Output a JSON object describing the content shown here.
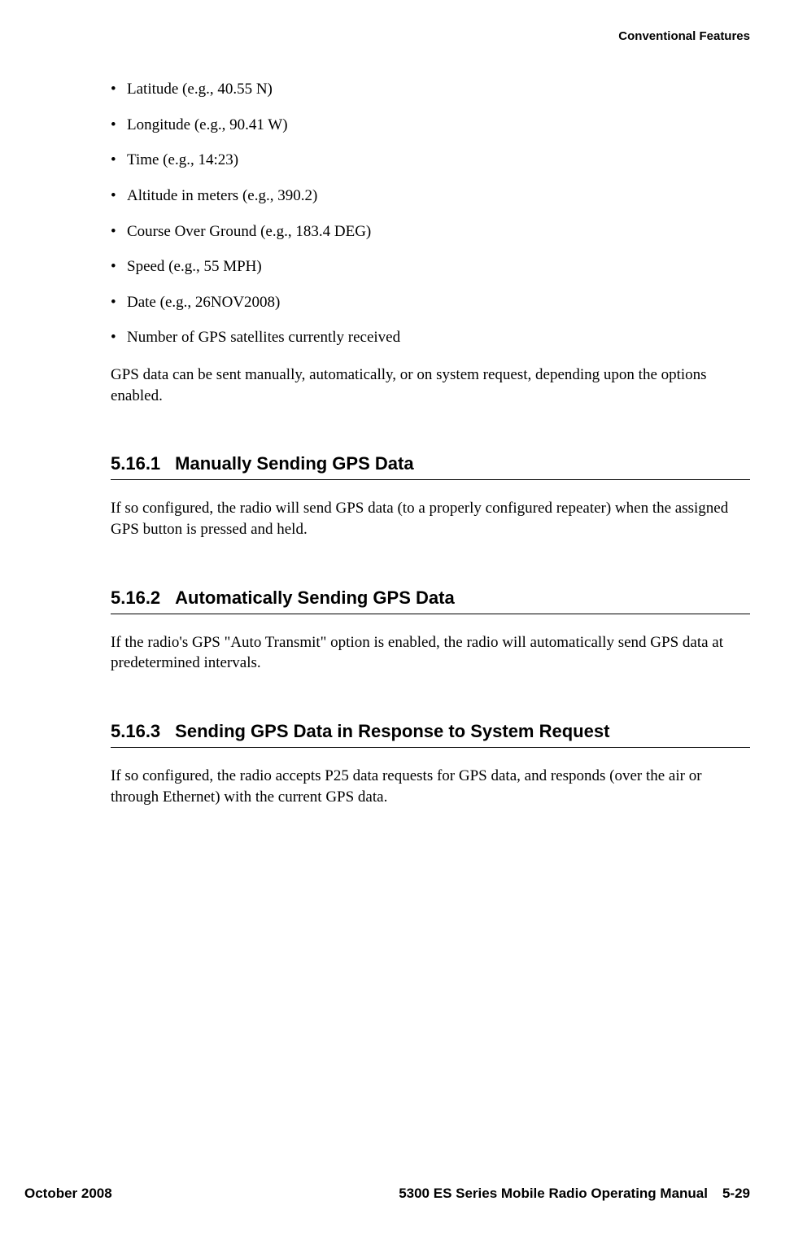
{
  "running_head": "Conventional Features",
  "bullets": [
    "Latitude (e.g., 40.55 N)",
    "Longitude (e.g., 90.41 W)",
    "Time (e.g., 14:23)",
    "Altitude in meters (e.g., 390.2)",
    "Course Over Ground (e.g., 183.4 DEG)",
    "Speed (e.g., 55 MPH)",
    "Date (e.g., 26NOV2008)",
    "Number of GPS satellites currently received"
  ],
  "para_after_bullets": "GPS data can be sent manually, automatically, or on system request, depending upon the options enabled.",
  "sections": [
    {
      "num": "5.16.1",
      "title": "Manually Sending GPS Data",
      "body": "If so configured, the radio will send GPS data (to a properly configured repeater) when the assigned GPS button is pressed and held."
    },
    {
      "num": "5.16.2",
      "title": "Automatically Sending GPS Data",
      "body": "If the radio's GPS \"Auto Transmit\" option is enabled, the radio will automatically send GPS data at predetermined intervals."
    },
    {
      "num": "5.16.3",
      "title": "Sending GPS Data in Response to System Request",
      "body": "If so configured, the radio accepts P25 data requests for GPS data, and responds (over the air or through Ethernet) with the current GPS data."
    }
  ],
  "footer": {
    "left": "October 2008",
    "manual": "5300 ES Series Mobile Radio Operating Manual",
    "page": "5-29"
  }
}
